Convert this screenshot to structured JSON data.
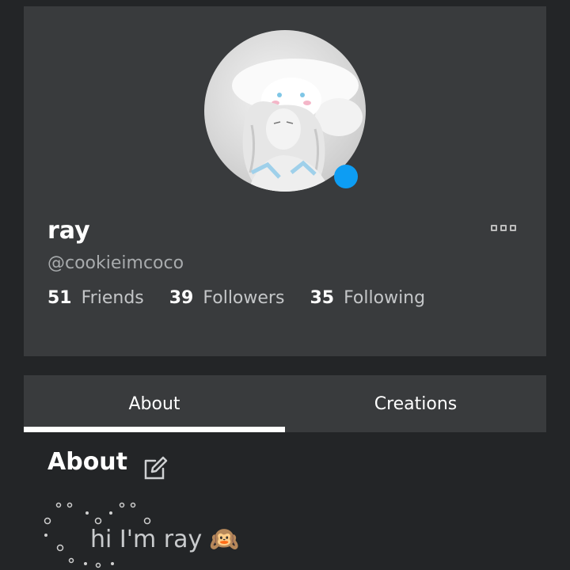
{
  "profile": {
    "display_name": "ray",
    "username": "@cookieimcoco",
    "online_status_color": "#0d9df3",
    "stats": [
      {
        "count": "51",
        "label": "Friends"
      },
      {
        "count": "39",
        "label": "Followers"
      },
      {
        "count": "35",
        "label": "Following"
      }
    ],
    "more_icon": "more-options-icon"
  },
  "tabs": [
    {
      "label": "About",
      "active": true
    },
    {
      "label": "Creations",
      "active": false
    }
  ],
  "about": {
    "heading": "About",
    "edit_icon": "edit-icon",
    "bio": "hi I'm ray 🙉"
  },
  "colors": {
    "background": "#232527",
    "card": "#393b3d",
    "text_primary": "#ffffff",
    "text_secondary": "#a8abad"
  }
}
